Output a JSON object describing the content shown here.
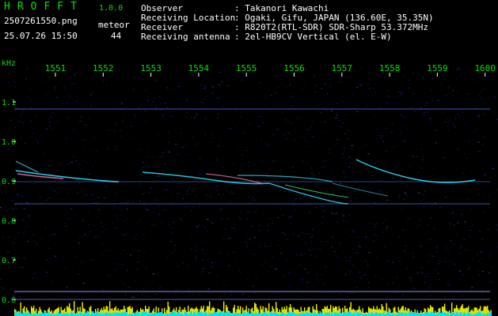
{
  "header": {
    "app_title": "HROFFT",
    "version": "1.0.0",
    "filename": "2507261550.png",
    "datetime": "25.07.26 15:50",
    "meteor_label": "meteor",
    "meteor_count": "44",
    "info": [
      {
        "label": "Observer",
        "value": ": Takanori Kawachi"
      },
      {
        "label": "Receiving Location",
        "value": ": Ogaki, Gifu, JAPAN (136.60E, 35.35N)"
      },
      {
        "label": "Receiver",
        "value": ": R820T2(RTL-SDR) SDR-Sharp 53.372MHz"
      },
      {
        "label": "Receiving antenna",
        "value": ": 2el-HB9CV Vertical (el. E-W)"
      }
    ]
  },
  "axes": {
    "y_unit": "kHz",
    "x_ticks": [
      "1551",
      "1552",
      "1553",
      "1554",
      "1555",
      "1556",
      "1557",
      "1558",
      "1559",
      "1600"
    ],
    "y_ticks": [
      "1.1",
      "1.0",
      "0.9",
      "0.8",
      "0.7",
      "0.6"
    ]
  },
  "colors": {
    "background": "#000000",
    "noise": "#1a2a8a",
    "trail": "#30e0ff",
    "hot": "#ff80c0",
    "histogram_yellow": "#f0f000",
    "histogram_cyan": "#00e0ff",
    "tick_text": "#00e000"
  }
}
